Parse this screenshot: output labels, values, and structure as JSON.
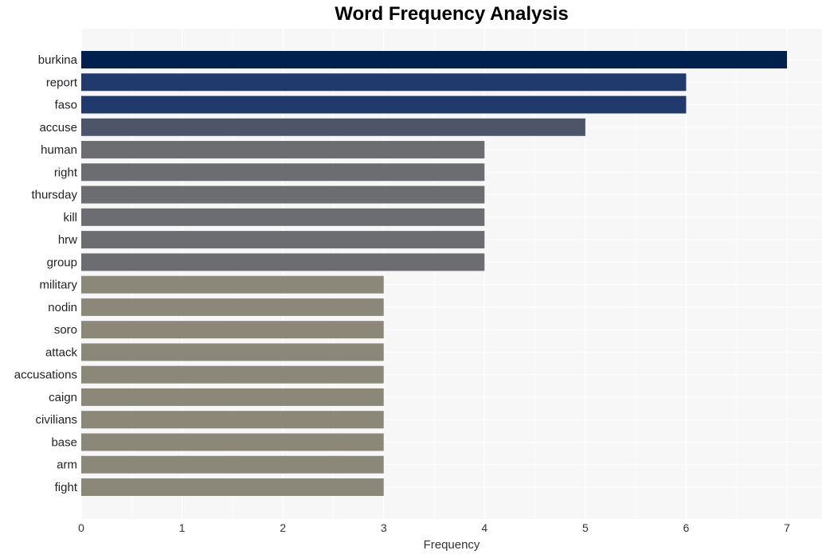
{
  "chart_data": {
    "type": "bar",
    "orientation": "horizontal",
    "title": "Word Frequency Analysis",
    "xlabel": "Frequency",
    "ylabel": "",
    "xlim": [
      0,
      7.35
    ],
    "xticks": [
      0,
      1,
      2,
      3,
      4,
      5,
      6,
      7
    ],
    "grid": true,
    "legend": "none",
    "categories": [
      "burkina",
      "report",
      "faso",
      "accuse",
      "human",
      "right",
      "thursday",
      "kill",
      "hrw",
      "group",
      "military",
      "nodin",
      "soro",
      "attack",
      "accusations",
      "caign",
      "civilians",
      "base",
      "arm",
      "fight"
    ],
    "values": [
      7,
      6,
      6,
      5,
      4,
      4,
      4,
      4,
      4,
      4,
      3,
      3,
      3,
      3,
      3,
      3,
      3,
      3,
      3,
      3
    ],
    "colors": [
      "#00204e",
      "#213a6e",
      "#213a6e",
      "#4d556b",
      "#6c6d71",
      "#6c6d71",
      "#6c6d71",
      "#6c6d71",
      "#6c6d71",
      "#6c6d71",
      "#8c8879",
      "#8c8879",
      "#8c8879",
      "#8c8879",
      "#8c8879",
      "#8c8879",
      "#8c8879",
      "#8c8879",
      "#8c8879",
      "#8c8879"
    ],
    "plot_background": "#f7f7f7"
  }
}
